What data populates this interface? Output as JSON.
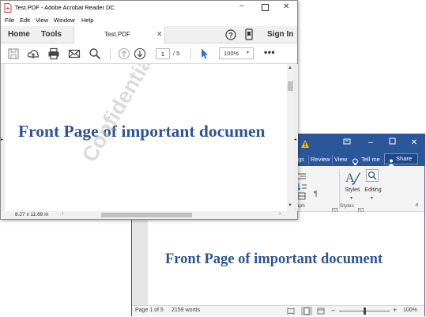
{
  "word": {
    "ribbon_tabs": [
      "gs",
      "Review",
      "View"
    ],
    "tell_me": "Tell me",
    "share": "Share",
    "styles_label": "Styles",
    "editing_label": "Editing",
    "group_paragraph": "aph",
    "group_styles": "Styles",
    "document_heading": "Front Page of important document",
    "status": {
      "page": "Page 1 of 5",
      "words": "2159 words",
      "zoom": "100%"
    },
    "colors": {
      "accent": "#2b579a"
    }
  },
  "acrobat": {
    "title": "Test.PDF - Adobe Acrobat Reader DC",
    "menu": [
      "File",
      "Edit",
      "View",
      "Window",
      "Help"
    ],
    "tabs": {
      "home": "Home",
      "tools": "Tools",
      "document": "Test.PDF",
      "sign_in": "Sign In"
    },
    "toolbar": {
      "page_current": "1",
      "page_total": "/  5",
      "zoom": "100%"
    },
    "document_heading": "Front Page of important documen",
    "watermark": "Confidential",
    "page_size": "8.27 x 11.69 in",
    "colors": {
      "heading": "#2f5496"
    }
  }
}
